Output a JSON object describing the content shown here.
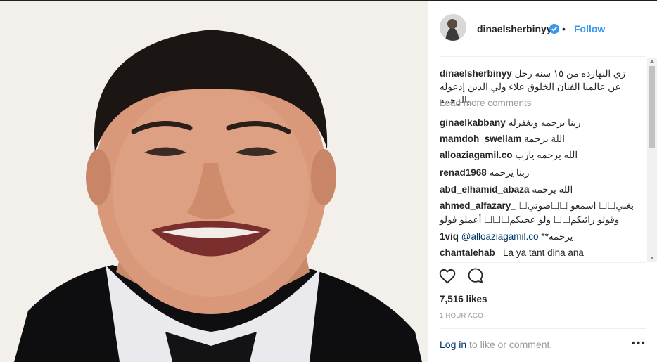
{
  "post": {
    "username": "dinaelsherbinyy",
    "follow_label": "Follow",
    "separator": "•",
    "caption_user": "dinaelsherbinyy",
    "caption_text": "زي النهارده من ١٥ سنه رحل عن عالمنا الفنان الخلوق علاء ولي الدين إدعوله بالرحمه",
    "load_more": "Load more comments",
    "comments": [
      {
        "user": "ginaelkabbany",
        "text": "ربنا يرحمه ويغفرله"
      },
      {
        "user": "mamdoh_swellam",
        "text": "اللة يرحمة"
      },
      {
        "user": "alloaziagamil.co",
        "text": "الله يرحمه يارب"
      },
      {
        "user": "renad1968",
        "text": "ربنا يرحمه"
      },
      {
        "user": "abd_elhamid_abaza",
        "text": "اللة يرحمه"
      },
      {
        "user": "ahmed_alfazary_",
        "text": "بغني☐☐ اسمعو ☐☐صوتي☐",
        "text2": "وقولو رائيكم☐☐ ولو عجبكم☐☐☐ أعملو فولو"
      },
      {
        "user": "1viq",
        "mention": "@alloaziagamil.co",
        "text": "يرحمه**"
      },
      {
        "user": "chantalehab_",
        "text": "La ya tant dina ana"
      }
    ],
    "likes": "7,516 likes",
    "time": "1 HOUR AGO",
    "login_link": "Log in",
    "login_rest": " to like or comment.",
    "more_options": "•••"
  }
}
